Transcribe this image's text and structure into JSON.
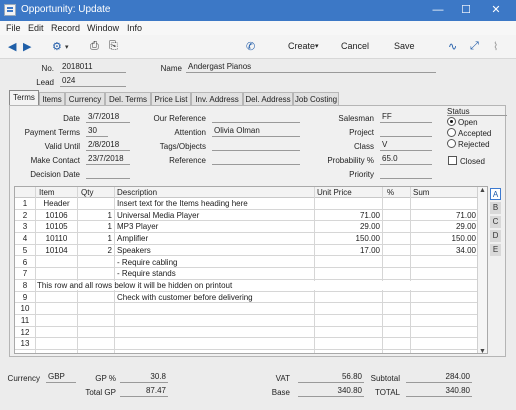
{
  "window": {
    "title": "Opportunity: Update",
    "minimize_glyph": "—",
    "maximize_glyph": "☐",
    "close_glyph": "✕"
  },
  "menu": [
    "File",
    "Edit",
    "Record",
    "Window",
    "Info"
  ],
  "toolbar": {
    "create_label": "Create",
    "cancel_label": "Cancel",
    "save_label": "Save"
  },
  "header": {
    "no_label": "No.",
    "no_value": "2018011",
    "lead_label": "Lead",
    "lead_value": "024",
    "name_label": "Name",
    "name_value": "Andergast Pianos"
  },
  "tabs": [
    "Terms",
    "Items",
    "Currency",
    "Del. Terms",
    "Price List",
    "Inv. Address",
    "Del. Address",
    "Job Costing"
  ],
  "terms": {
    "date_label": "Date",
    "date_value": "3/7/2018",
    "payment_terms_label": "Payment Terms",
    "payment_terms_value": "30",
    "valid_until_label": "Valid Until",
    "valid_until_value": "2/8/2018",
    "make_contact_label": "Make Contact",
    "make_contact_value": "23/7/2018",
    "decision_date_label": "Decision Date",
    "decision_date_value": "",
    "our_reference_label": "Our Reference",
    "our_reference_value": "",
    "attention_label": "Attention",
    "attention_value": "Olivia Olman",
    "tags_label": "Tags/Objects",
    "tags_value": "",
    "reference_label": "Reference",
    "reference_value": "",
    "salesman_label": "Salesman",
    "salesman_value": "FF",
    "project_label": "Project",
    "project_value": "",
    "class_label": "Class",
    "class_value": "V",
    "probability_label": "Probability %",
    "probability_value": "65.0",
    "priority_label": "Priority",
    "priority_value": ""
  },
  "status": {
    "title": "Status",
    "options": [
      "Open",
      "Accepted",
      "Rejected"
    ],
    "selected": "Open",
    "closed_label": "Closed"
  },
  "grid": {
    "columns": [
      "Item",
      "Qty",
      "Description",
      "Unit Price",
      "%",
      "Sum"
    ],
    "rows": [
      {
        "n": "1",
        "item": "Header",
        "qty": "",
        "desc": "Insert text for the Items heading here",
        "price": "",
        "pct": "",
        "sum": ""
      },
      {
        "n": "2",
        "item": "10106",
        "qty": "1",
        "desc": "Universal Media Player",
        "price": "71.00",
        "pct": "",
        "sum": "71.00"
      },
      {
        "n": "3",
        "item": "10105",
        "qty": "1",
        "desc": "MP3 Player",
        "price": "29.00",
        "pct": "",
        "sum": "29.00"
      },
      {
        "n": "4",
        "item": "10110",
        "qty": "1",
        "desc": "Amplifier",
        "price": "150.00",
        "pct": "",
        "sum": "150.00"
      },
      {
        "n": "5",
        "item": "10104",
        "qty": "2",
        "desc": "Speakers",
        "price": "17.00",
        "pct": "",
        "sum": "34.00"
      },
      {
        "n": "6",
        "item": "",
        "qty": "",
        "desc": "- Require cabling",
        "price": "",
        "pct": "",
        "sum": ""
      },
      {
        "n": "7",
        "item": "",
        "qty": "",
        "desc": "- Require stands",
        "price": "",
        "pct": "",
        "sum": ""
      },
      {
        "n": "8",
        "item": "This row and all rows below it will be hidden on printout",
        "qty": "",
        "desc": "",
        "price": "",
        "pct": "",
        "sum": ""
      },
      {
        "n": "9",
        "item": "",
        "qty": "",
        "desc": "Check with customer before delivering",
        "price": "",
        "pct": "",
        "sum": ""
      },
      {
        "n": "10",
        "item": "",
        "qty": "",
        "desc": "",
        "price": "",
        "pct": "",
        "sum": ""
      },
      {
        "n": "11",
        "item": "",
        "qty": "",
        "desc": "",
        "price": "",
        "pct": "",
        "sum": ""
      },
      {
        "n": "12",
        "item": "",
        "qty": "",
        "desc": "",
        "price": "",
        "pct": "",
        "sum": ""
      },
      {
        "n": "13",
        "item": "",
        "qty": "",
        "desc": "",
        "price": "",
        "pct": "",
        "sum": ""
      }
    ],
    "side_tabs": [
      "A",
      "B",
      "C",
      "D",
      "E"
    ],
    "active_side_tab": "A"
  },
  "footer": {
    "currency_label": "Currency",
    "currency_value": "GBP",
    "gp_pct_label": "GP %",
    "gp_pct_value": "30.8",
    "total_gp_label": "Total GP",
    "total_gp_value": "87.47",
    "vat_label": "VAT",
    "vat_value": "56.80",
    "base_label": "Base",
    "base_value": "340.80",
    "subtotal_label": "Subtotal",
    "subtotal_value": "284.00",
    "total_label": "TOTAL",
    "total_value": "340.80"
  },
  "colors": {
    "title_bar": "#3c78c6",
    "accent": "#1f5fa8"
  }
}
